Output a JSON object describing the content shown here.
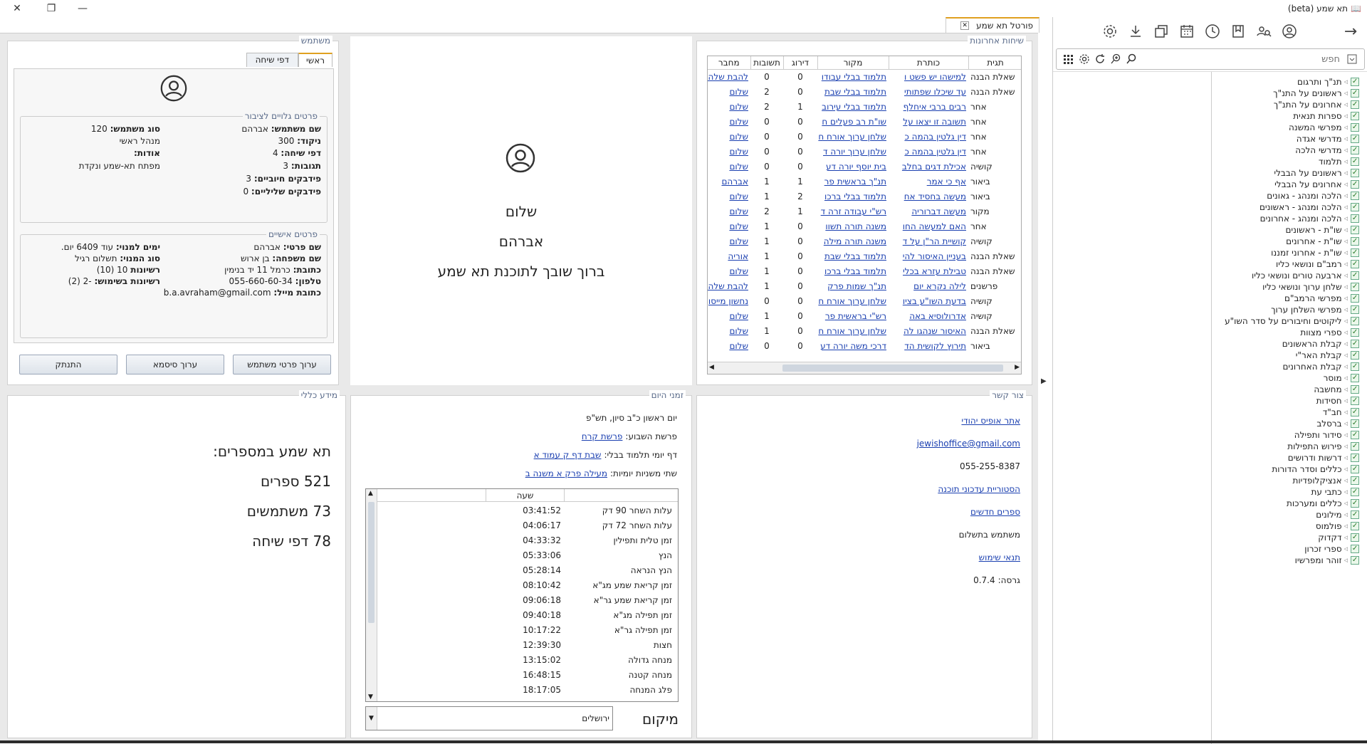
{
  "app": {
    "title": "תא שמע (beta)",
    "main_tab": "פורטל תא שמע"
  },
  "window": {
    "close_icon": "close-icon",
    "maximize_icon": "restore-icon",
    "minimize_icon": "minimize-icon"
  },
  "toolbar": {
    "icons": [
      "user-circle-icon",
      "people-search-icon",
      "bookmark-icon",
      "clock-icon",
      "calendar-icon",
      "copy-icon",
      "download-icon",
      "gear-icon"
    ],
    "forward_icon": "arrow-right-icon"
  },
  "search": {
    "placeholder": "חפש"
  },
  "tree": {
    "items": [
      "תנ\"ך ותרגום",
      "ראשונים על התנ\"ך",
      "אחרונים על התנ\"ך",
      "ספרות תנאית",
      "מפרשי המשנה",
      "מדרשי אגדה",
      "מדרשי הלכה",
      "תלמוד",
      "ראשונים על הבבלי",
      "אחרונים על הבבלי",
      "הלכה ומנהג - גאונים",
      "הלכה ומנהג - ראשונים",
      "הלכה ומנהג - אחרונים",
      "שו\"ת - ראשונים",
      "שו\"ת - אחרונים",
      "שו\"ת - אחרוני זמננו",
      "רמב\"ם ונושאי כליו",
      "ארבעה טורים ונושאי כליו",
      "שלחן ערוך ונושאי כליו",
      "מפרשי הרמב\"ם",
      "מפרשי השלחן ערוך",
      "ליקוטים וחיבורים על סדר השו\"ע",
      "ספרי מצוות",
      "קבלת הראשונים",
      "קבלת האר\"י",
      "קבלת האחרונים",
      "מוסר",
      "מחשבה",
      "חסידות",
      "חב\"ד",
      "ברסלב",
      "סידור ותפילה",
      "פירוש התפילות",
      "דרשות ודרושים",
      "כללים וסדר הדורות",
      "אנציקלופדיות",
      "כתבי עת",
      "כללים ומערכות",
      "מילונים",
      "פולמוס",
      "דקדוק",
      "ספרי זכרון",
      "זוהר ומפרשיו"
    ]
  },
  "discussions": {
    "title": "שיחות אחרונות",
    "columns": [
      "תגית",
      "כותרת",
      "מקור",
      "דירוג",
      "תשובות",
      "מחבר"
    ],
    "rows": [
      [
        "שאלת הבנה",
        "למישהו יש פשט ו",
        "תלמוד בבלי עבודו",
        "0",
        "0",
        "להבת שלהב"
      ],
      [
        "שאלת הבנה",
        "עד שיכלו שפתותי",
        "תלמוד בבלי שבת",
        "0",
        "2",
        "שלום"
      ],
      [
        "אחר",
        "רבים ברבי איחלף",
        "תלמוד בבלי עירוב",
        "1",
        "2",
        "שלום"
      ],
      [
        "אחר",
        "תשובה זו יצאו על",
        "שו\"ת רב פעלים ח",
        "0",
        "0",
        "שלום"
      ],
      [
        "אחר",
        "דין גלטין בהמה כ",
        "שלחן ערוך אורח ח",
        "0",
        "0",
        "שלום"
      ],
      [
        "אחר",
        "דין גלטין בהמה כ",
        "שלחן ערוך יורה ד",
        "0",
        "0",
        "שלום"
      ],
      [
        "קושיה",
        "אכילת דגים בחלב",
        "בית יוסף יורה דע",
        "0",
        "0",
        "שלום"
      ],
      [
        "ביאור",
        "אף כי אמר",
        "תנ\"ך בראשית פר",
        "1",
        "1",
        "אברהם"
      ],
      [
        "ביאור",
        "מעשה בחסיד אח",
        "תלמוד בבלי ברכו",
        "2",
        "1",
        "שלום"
      ],
      [
        "מקור",
        "מעשה דברוריה",
        "רש\"י עבודה זרה ד",
        "1",
        "2",
        "שלום"
      ],
      [
        "אחר",
        "האם למעשה החו",
        "משנה תורה תשוו",
        "0",
        "1",
        "שלום"
      ],
      [
        "קושיה",
        "קושיית הר\"ן על ד",
        "משנה תורה מילה",
        "0",
        "1",
        "שלום"
      ],
      [
        "שאלת הבנה",
        "בעניין האיסור להי",
        "תלמוד בבלי שבת",
        "0",
        "1",
        "אוריה"
      ],
      [
        "שאלת הבנה",
        "טבילת עזרא בכלי",
        "תלמוד בבלי ברכו",
        "0",
        "1",
        "שלום"
      ],
      [
        "פרשנים",
        "לילה נקרא יום",
        "תנ\"ך שמות פרק",
        "0",
        "1",
        "להבת שלהב"
      ],
      [
        "קושיה",
        "בדעת השו\"ע בציו",
        "שלחן ערוך אורח ח",
        "0",
        "0",
        "נחשון מייסון"
      ],
      [
        "קושיה",
        "אדרולוסיא באה",
        "רש\"י בראשית פר",
        "0",
        "1",
        "שלום"
      ],
      [
        "שאלת הבנה",
        "האיסור שנהגו לה",
        "שלחן ערוך אורח ח",
        "0",
        "1",
        "שלום"
      ],
      [
        "ביאור",
        "תירוץ לקושית הד",
        "דרכי משה יורה דע",
        "0",
        "0",
        "שלום"
      ]
    ]
  },
  "welcome": {
    "greeting": "שלום",
    "name": "אברהם",
    "message": "ברוך שובך לתוכנת תא שמע"
  },
  "user": {
    "title": "משתמש",
    "tabs": [
      "ראשי",
      "דפי שיחה"
    ],
    "public_title": "פרטים גלויים לציבור",
    "public": [
      {
        "k": "שם משתמש:",
        "v": "אברהם"
      },
      {
        "k": "סוג משתמש:",
        "v": "120"
      },
      {
        "k": "ניקוד:",
        "v": "300"
      },
      {
        "k": "",
        "v": "מנהל ראשי"
      },
      {
        "k": "דפי שיחה:",
        "v": "4"
      },
      {
        "k": "אודות:",
        "v": ""
      },
      {
        "k": "תגובות:",
        "v": "3"
      },
      {
        "k": "",
        "v": "מפתח תא-שמע ונקדת"
      },
      {
        "k": "פידבקים חיוביים:",
        "v": "3"
      },
      {
        "k": "פידבקים שליליים:",
        "v": "0"
      }
    ],
    "personal_title": "פרטים אישיים",
    "personal": [
      {
        "k": "שם פרטי:",
        "v": "אברהם"
      },
      {
        "k": "ימים למנוי:",
        "v": "עוד 6409 יום."
      },
      {
        "k": "שם משפחה:",
        "v": "בן ארוש"
      },
      {
        "k": "סוג המנוי:",
        "v": "תשלום רגיל"
      },
      {
        "k": "כתובת:",
        "v": "כרמל 11 יד בנימין"
      },
      {
        "k": "רשיונות",
        "v": "10 (10)"
      },
      {
        "k": "טלפון:",
        "v": "055-660-60-34"
      },
      {
        "k": "רשיונות בשימוש:",
        "v": "-2 (2)"
      },
      {
        "k": "כתובת מייל:",
        "v": "b.a.avraham@gmail.com"
      }
    ],
    "buttons": {
      "edit_details": "ערוך פרטי משתמש",
      "edit_password": "ערוך סיסמא",
      "logout": "התנתק"
    }
  },
  "contact": {
    "title": "צור קשר",
    "site": "אתר אופיס יהודי",
    "email": "jewishoffice@gmail.com",
    "phone": "055-255-8387",
    "history": "הסטוריית עדכוני תוכנה",
    "new_books": "ספרים חדשים",
    "paid_user": "משתמש בתשלום",
    "terms": "תנאי שימוש",
    "version_label": "גרסה:",
    "version": "0.7.4"
  },
  "times": {
    "title": "זמני היום",
    "date": "יום ראשון כ\"ב סיון, תש\"פ",
    "parasha_label": "פרשת השבוע:",
    "parasha": "פרשת קרח",
    "daf_label": "דף יומי תלמוד בבלי:",
    "daf": "שבת דף ק עמוד א",
    "mishna_label": "שתי משניות יומיות:",
    "mishna": "מעילה פרק א משנה ב",
    "col_time": "שעה",
    "rows": [
      [
        "עלות השחר 90 דק",
        "03:41:52"
      ],
      [
        "עלות השחר 72 דק",
        "04:06:17"
      ],
      [
        "זמן טלית ותפילין",
        "04:33:32"
      ],
      [
        "הנץ",
        "05:33:06"
      ],
      [
        "הנץ הנראה",
        "05:28:14"
      ],
      [
        "זמן קריאת שמע מג\"א",
        "08:10:42"
      ],
      [
        "זמן קריאת שמע גר\"א",
        "09:06:18"
      ],
      [
        "זמן תפילה מג\"א",
        "09:40:18"
      ],
      [
        "זמן תפילה גר\"א",
        "10:17:22"
      ],
      [
        "חצות",
        "12:39:30"
      ],
      [
        "מנחה גדולה",
        "13:15:02"
      ],
      [
        "מנחה קטנה",
        "16:48:15"
      ],
      [
        "פלג המנחה",
        "18:17:05"
      ]
    ],
    "location_label": "מיקום",
    "location": "ירושלים"
  },
  "info": {
    "title": "מידע כללי",
    "heading": "תא שמע במספרים:",
    "lines": [
      "521 ספרים",
      "73 משתמשים",
      "78 דפי שיחה"
    ]
  }
}
